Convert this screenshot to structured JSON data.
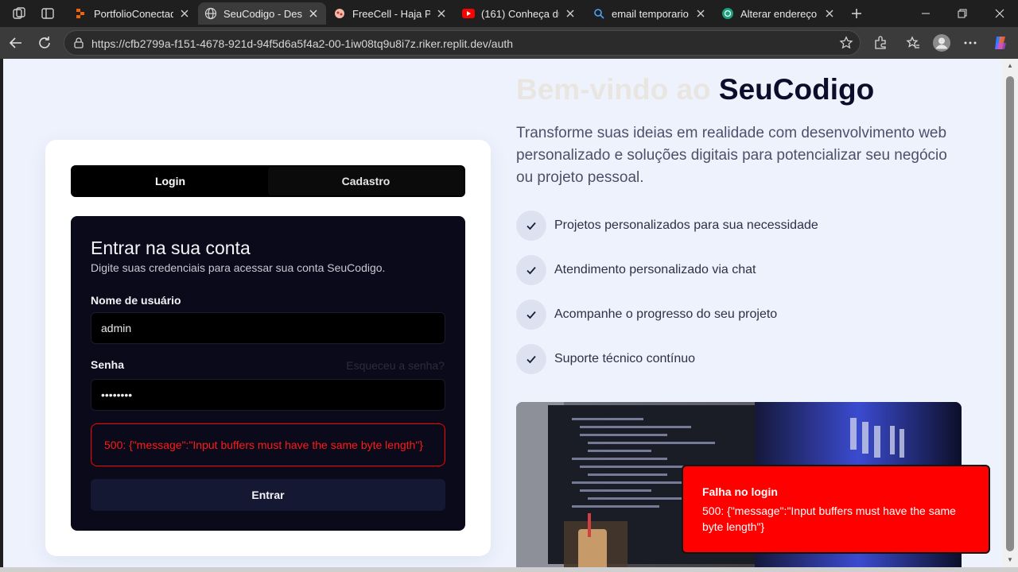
{
  "browser": {
    "tabs": [
      {
        "title": "PortfolioConectado",
        "active": false
      },
      {
        "title": "SeuCodigo - Desenvolvimento",
        "active": true
      },
      {
        "title": "FreeCell - Haja Paciência",
        "active": false
      },
      {
        "title": "(161) Conheça dua",
        "active": false
      },
      {
        "title": "email temporario -",
        "active": false
      },
      {
        "title": "Alterar endereço de",
        "active": false
      }
    ],
    "url": "https://cfb2799a-f151-4678-921d-94f5d6a5f4a2-00-1iw08tq9u8i7z.riker.replit.dev/auth"
  },
  "auth": {
    "tabs": {
      "login": "Login",
      "register": "Cadastro"
    },
    "form": {
      "title": "Entrar na sua conta",
      "subtitle": "Digite suas credenciais para acessar sua conta SeuCodigo.",
      "username_label": "Nome de usuário",
      "username_value": "admin",
      "password_label": "Senha",
      "password_value": "••••••••",
      "forgot_label": "Esqueceu a senha?",
      "error": "500: {\"message\":\"Input buffers must have the same byte length\"}",
      "submit_label": "Entrar"
    }
  },
  "hero": {
    "title_prefix": "Bem-vindo ao ",
    "title_brand": "SeuCodigo",
    "description": "Transforme suas ideias em realidade com desenvolvimento web personalizado e soluções digitais para potencializar seu negócio ou projeto pessoal.",
    "features": [
      "Projetos personalizados para sua necessidade",
      "Atendimento personalizado via chat",
      "Acompanhe o progresso do seu projeto",
      "Suporte técnico contínuo"
    ]
  },
  "toast": {
    "title": "Falha no login",
    "message": "500: {\"message\":\"Input buffers must have the same byte length\"}"
  },
  "colors": {
    "page_bg": "#eef2fd",
    "form_bg": "#0a0a1a",
    "error": "#ff0000",
    "brand_dark": "#0d0d2b"
  }
}
